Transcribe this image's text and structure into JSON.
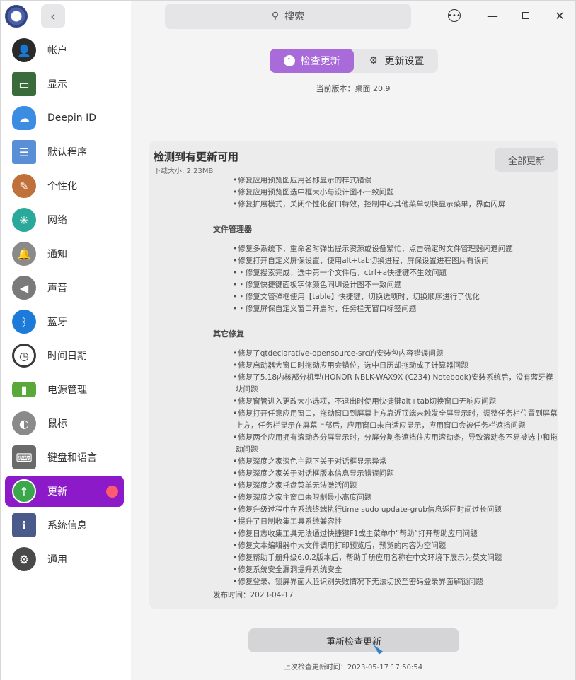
{
  "search": {
    "placeholder": "搜索"
  },
  "sidebar": {
    "items": [
      {
        "label": "帐户",
        "icon": "account-icon",
        "color": "#2a2a2a"
      },
      {
        "label": "显示",
        "icon": "display-icon",
        "color": "#3a6b3a"
      },
      {
        "label": "Deepin ID",
        "icon": "cloud-icon",
        "color": "#3a8de0"
      },
      {
        "label": "默认程序",
        "icon": "default-apps-icon",
        "color": "#5a8fd8"
      },
      {
        "label": "个性化",
        "icon": "palette-icon",
        "color": "#c0703a"
      },
      {
        "label": "网络",
        "icon": "network-icon",
        "color": "#2aa89a"
      },
      {
        "label": "通知",
        "icon": "bell-icon",
        "color": "#8a8a8a"
      },
      {
        "label": "声音",
        "icon": "speaker-icon",
        "color": "#7a7a7a"
      },
      {
        "label": "蓝牙",
        "icon": "bluetooth-icon",
        "color": "#1c7ad8"
      },
      {
        "label": "时间日期",
        "icon": "clock-icon",
        "color": "#3a3a3a"
      },
      {
        "label": "电源管理",
        "icon": "battery-icon",
        "color": "#5aa83a"
      },
      {
        "label": "鼠标",
        "icon": "mouse-icon",
        "color": "#8a8a8a"
      },
      {
        "label": "键盘和语言",
        "icon": "keyboard-icon",
        "color": "#6a6a6a"
      },
      {
        "label": "更新",
        "icon": "update-arrow-icon",
        "color": "#3aa84a",
        "active": true
      },
      {
        "label": "系统信息",
        "icon": "system-info-icon",
        "color": "#4a5a8a"
      },
      {
        "label": "通用",
        "icon": "general-icon",
        "color": "#4a4a4a"
      }
    ]
  },
  "tabs": {
    "check": "检查更新",
    "settings": "更新设置"
  },
  "version_text": "当前版本：桌面 20.9",
  "update": {
    "title": "检测到有更新可用",
    "size": "下载大小: 2.23MB",
    "update_all": "全部更新"
  },
  "notes": {
    "top_lines": [
      "修复应用预览图应用名称显示的样式错误",
      "修复应用预览图选中框大小与设计图不一致问题",
      "修复扩展模式，关闭个性化窗口特效，控制中心其他菜单切换显示菜单，界面闪屏"
    ],
    "section1_title": "文件管理器",
    "section1_lines": [
      "修复多系统下，重命名时弹出提示资源或设备繁忙，点击确定时文件管理器闪退问题",
      "修复打开自定义屏保设置，使用alt+tab切换进程，屏保设置进程图片有误问",
      "・修复搜索完成，选中第一个文件后，ctrl+a快捷键不生效问题",
      "・修复快捷键面板字体颜色同UI设计图不一致问题",
      "・修复文管弹框使用【table】快捷键，切换选项时，切换顺序进行了优化",
      "・修复屏保自定义窗口开启时，任务栏无窗口标签问题"
    ],
    "section2_title": "其它修复",
    "section2_lines": [
      "修复了qtdeclarative-opensource-src的安装包内容错误问题",
      "修复启动器大窗口时拖动应用会错位，选中日历却拖动成了计算器问题",
      "修复了5.18内核部分机型(HONOR NBLK-WAX9X (C234) Notebook)安装系统后，没有蓝牙模块问题",
      "修复窗管进入更改大小选项，不退出时使用快捷键alt+tab切换窗口无响应问题",
      "修复打开任意应用窗口，拖动窗口到屏幕上方靠近顶端未触发全屏显示时，调整任务栏位置到屏幕上方，任务栏显示在屏幕上部后，应用窗口未自适应显示，应用窗口会被任务栏遮挡问题",
      "修复两个应用拥有滚动条分屏显示时，分屏分割条遮挡住应用滚动条，导致滚动条不易被选中和拖动问题",
      "修复深度之家深色主题下关于对话框显示异常",
      "修复深度之家关于对话框版本信息显示错误问题",
      "修复深度之家托盘菜单无法激活问题",
      "修复深度之家主窗口未限制最小高度问题",
      "修复升级过程中在系统终端执行time sudo update-grub信息返回时间过长问题",
      "提升了日制收集工具系统兼容性",
      "修复日志收集工具无法通过快捷键F1或主菜单中“帮助”打开帮助应用问题",
      "修复文本编辑器中大文件调用打印预览后，预览的内容为空问题",
      "修复帮助手册升级6.0.2版本后，帮助手册应用名称在中文环境下展示为英文问题",
      "修复系统安全漏洞提升系统安全",
      "修复登录、锁屏界面人脸识别失败情况下无法切换至密码登录界面解锁问题"
    ],
    "publish": "发布时间：2023-04-17"
  },
  "recheck_label": "重新检查更新",
  "last_check": "上次检查更新时间：2023-05-17 17:50:54",
  "accent": "#8c1ac9"
}
